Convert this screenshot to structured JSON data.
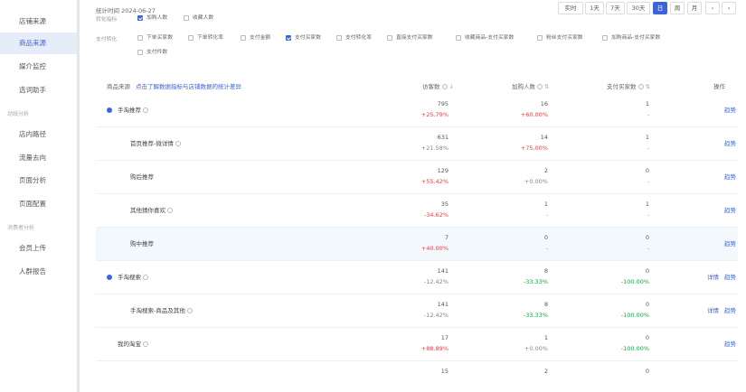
{
  "sidebar": {
    "items": [
      {
        "label": "店铺来源",
        "active": false
      },
      {
        "label": "商品来源",
        "active": true
      },
      {
        "label": "媒介监控",
        "active": false
      },
      {
        "label": "选词助手",
        "active": false
      },
      {
        "label": "店内路径",
        "active": false
      },
      {
        "label": "流量去向",
        "active": false
      },
      {
        "label": "页面分析",
        "active": false
      },
      {
        "label": "页面配置",
        "active": false
      },
      {
        "label": "会员上传",
        "active": false
      },
      {
        "label": "人群报告",
        "active": false
      }
    ],
    "section_dynamic": "动线分析",
    "section_consumer": "消费者分析"
  },
  "header": {
    "stat_time": "统计时间 2024-06-27",
    "ranges": [
      "实时",
      "1天",
      "7天",
      "30天",
      "日",
      "周",
      "月"
    ],
    "selected_range": "日",
    "prev_icon": "‹",
    "next_icon": "›"
  },
  "filters": {
    "row1_label": "转化指标",
    "row1_options": [
      {
        "label": "加购人数",
        "checked": true
      },
      {
        "label": "收藏人数",
        "checked": false
      }
    ],
    "row2_label": "支付转化",
    "row2_options": [
      {
        "label": "下单买家数",
        "checked": false
      },
      {
        "label": "下单转化率",
        "checked": false
      },
      {
        "label": "支付金额",
        "checked": false
      },
      {
        "label": "支付买家数",
        "checked": true
      },
      {
        "label": "支付转化率",
        "checked": false
      },
      {
        "label": "直接支付买家数",
        "checked": false
      },
      {
        "label": "收藏商品-支付买家数",
        "checked": false
      },
      {
        "label": "粉丝支付买家数",
        "checked": false
      },
      {
        "label": "加购商品-支付买家数",
        "checked": false
      }
    ],
    "row3_options": [
      {
        "label": "支付件数",
        "checked": false
      }
    ]
  },
  "table": {
    "headers": {
      "source": "商品来源",
      "hint": "点击了解数据指标与店铺数据的统计差异",
      "visitors": "访客数",
      "cart": "加购人数",
      "buyers": "支付买家数",
      "ops": "操作"
    },
    "rows": [
      {
        "name": "手淘推荐",
        "level": 0,
        "dot": true,
        "info": true,
        "highlight": false,
        "visitors": "795",
        "visitors_chg": "+25.79%",
        "visitors_dir": "up",
        "cart": "16",
        "cart_chg": "+60.00%",
        "cart_dir": "up",
        "buyers": "1",
        "buyers_chg": "-",
        "buyers_dir": "none",
        "ops": [
          "趋势"
        ]
      },
      {
        "name": "首页推荐-微详情",
        "level": 1,
        "dot": false,
        "info": true,
        "highlight": false,
        "visitors": "631",
        "visitors_chg": "+21.58%",
        "visitors_dir": "none",
        "cart": "14",
        "cart_chg": "+75.00%",
        "cart_dir": "up",
        "buyers": "1",
        "buyers_chg": "-",
        "buyers_dir": "none",
        "ops": [
          "趋势"
        ]
      },
      {
        "name": "购后推荐",
        "level": 1,
        "dot": false,
        "info": false,
        "highlight": false,
        "visitors": "129",
        "visitors_chg": "+55.42%",
        "visitors_dir": "up",
        "cart": "2",
        "cart_chg": "+0.00%",
        "cart_dir": "none",
        "buyers": "0",
        "buyers_chg": "-",
        "buyers_dir": "none",
        "ops": [
          "趋势"
        ]
      },
      {
        "name": "其他猜你喜欢",
        "level": 1,
        "dot": false,
        "info": true,
        "highlight": false,
        "visitors": "35",
        "visitors_chg": "-34.62%",
        "visitors_dir": "up",
        "cart": "1",
        "cart_chg": "-",
        "cart_dir": "none",
        "buyers": "1",
        "buyers_chg": "-",
        "buyers_dir": "none",
        "ops": [
          "趋势"
        ]
      },
      {
        "name": "购中推荐",
        "level": 1,
        "dot": false,
        "info": false,
        "highlight": true,
        "visitors": "7",
        "visitors_chg": "+40.00%",
        "visitors_dir": "up",
        "cart": "0",
        "cart_chg": "-",
        "cart_dir": "none",
        "buyers": "0",
        "buyers_chg": "-",
        "buyers_dir": "none",
        "ops": [
          "趋势"
        ]
      },
      {
        "name": "手淘搜索",
        "level": 0,
        "dot": true,
        "info": true,
        "highlight": false,
        "visitors": "141",
        "visitors_chg": "-12.42%",
        "visitors_dir": "none",
        "cart": "8",
        "cart_chg": "-33.33%",
        "cart_dir": "down",
        "buyers": "0",
        "buyers_chg": "-100.00%",
        "buyers_dir": "down",
        "ops": [
          "详情",
          "趋势"
        ]
      },
      {
        "name": "手淘搜索-商品及其他",
        "level": 1,
        "dot": false,
        "info": true,
        "highlight": false,
        "visitors": "141",
        "visitors_chg": "-12.42%",
        "visitors_dir": "none",
        "cart": "8",
        "cart_chg": "-33.33%",
        "cart_dir": "down",
        "buyers": "0",
        "buyers_chg": "-100.00%",
        "buyers_dir": "down",
        "ops": [
          "详情",
          "趋势"
        ]
      },
      {
        "name": "我的淘宝",
        "level": 0,
        "dot": false,
        "info": true,
        "highlight": false,
        "visitors": "17",
        "visitors_chg": "+88.89%",
        "visitors_dir": "up",
        "cart": "1",
        "cart_chg": "+0.00%",
        "cart_dir": "none",
        "buyers": "0",
        "buyers_chg": "-100.00%",
        "buyers_dir": "down",
        "ops": [
          "趋势"
        ]
      },
      {
        "name": "",
        "level": 0,
        "dot": false,
        "info": false,
        "highlight": false,
        "visitors": "15",
        "visitors_chg": "",
        "visitors_dir": "none",
        "cart": "2",
        "cart_chg": "",
        "cart_dir": "none",
        "buyers": "0",
        "buyers_chg": "",
        "buyers_dir": "none",
        "ops": []
      }
    ]
  },
  "colors": {
    "accent": "#3b66d9",
    "up": "#e0474e",
    "down": "#22a24a"
  }
}
